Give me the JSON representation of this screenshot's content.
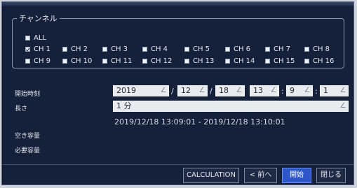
{
  "channels": {
    "legend": "チャンネル",
    "all_label": "ALL",
    "row1": [
      "CH 1",
      "CH 2",
      "CH 3",
      "CH 4",
      "CH 5",
      "CH 6",
      "CH 7",
      "CH 8"
    ],
    "row2": [
      "CH 9",
      "CH 10",
      "CH 11",
      "CH 12",
      "CH 13",
      "CH 14",
      "CH 15",
      "CH 16"
    ]
  },
  "form": {
    "start_time_label": "開始時刻",
    "year": "2019",
    "month": "12",
    "day": "18",
    "hour": "13",
    "minute": "9",
    "second": "1",
    "date_sep": "/",
    "time_sep": ":",
    "duration_label": "長さ",
    "duration_value": "1 分",
    "time_range": "2019/12/18 13:09:01 - 2019/12/18 13:10:01",
    "free_space_label": "空き容量",
    "required_space_label": "必要容量"
  },
  "buttons": {
    "calculation": "CALCULATION",
    "prev": "< 前へ",
    "start": "開始",
    "close": "閉じる"
  },
  "colors": {
    "dialog_bg": "#15203a",
    "field_bg": "#e9ebef",
    "primary_button": "#2c56c9"
  }
}
